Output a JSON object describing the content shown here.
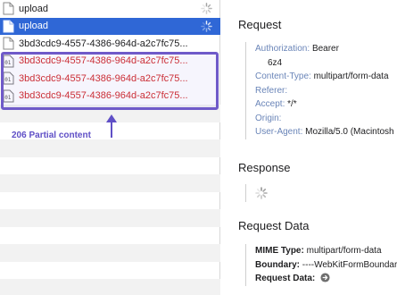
{
  "request_list": {
    "rows": [
      {
        "label": "upload",
        "state": "loading"
      },
      {
        "label": "upload",
        "state": "selected-loading"
      },
      {
        "label": "3bd3cdc9-4557-4386-964d-a2c7fc75...",
        "state": "normal"
      },
      {
        "label": "3bd3cdc9-4557-4386-964d-a2c7fc75...",
        "state": "error"
      },
      {
        "label": "3bd3cdc9-4557-4386-964d-a2c7fc75...",
        "state": "error"
      },
      {
        "label": "3bd3cdc9-4557-4386-964d-a2c7fc75...",
        "state": "error"
      }
    ],
    "annotation": "206 Partial content"
  },
  "details": {
    "request": {
      "title": "Request",
      "fields": [
        {
          "key": "Authorization:",
          "value": "Bearer"
        },
        {
          "key": "",
          "value": "6z4"
        },
        {
          "key": "Content-Type:",
          "value": "multipart/form-data"
        },
        {
          "key": "Referer:",
          "value": ""
        },
        {
          "key": "Accept:",
          "value": "*/*"
        },
        {
          "key": "Origin:",
          "value": ""
        },
        {
          "key": "User-Agent:",
          "value": "Mozilla/5.0 (Macintosh"
        }
      ]
    },
    "response": {
      "title": "Response"
    },
    "request_data": {
      "title": "Request Data",
      "fields": [
        {
          "key": "MIME Type:",
          "value": "multipart/form-data"
        },
        {
          "key": "Boundary:",
          "value": "----WebKitFormBoundary"
        },
        {
          "key": "Request Data:",
          "value": ""
        }
      ]
    }
  },
  "colors": {
    "selected_row": "#2f67d6",
    "error_text": "#d12a2a",
    "annotation": "#5f4fc6",
    "header_key": "#6a85b8"
  }
}
